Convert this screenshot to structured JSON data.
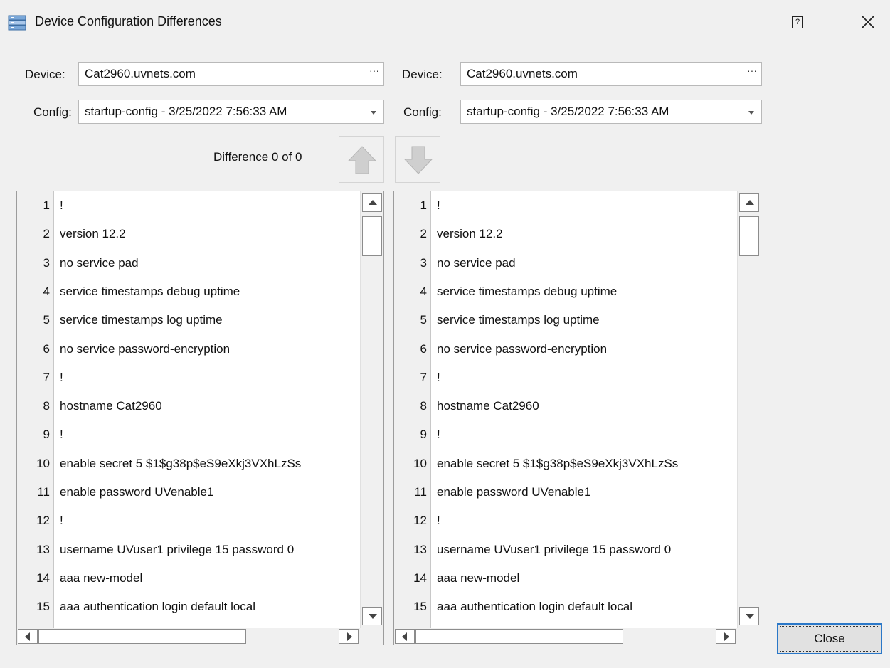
{
  "window": {
    "title": "Device Configuration Differences",
    "help_glyph": "?"
  },
  "left": {
    "device_label": "Device:",
    "device_value": "Cat2960.uvnets.com",
    "browse_glyph": "···",
    "config_label": "Config:",
    "config_value": "startup-config - 3/25/2022 7:56:33 AM"
  },
  "right": {
    "device_label": "Device:",
    "device_value": "Cat2960.uvnets.com",
    "browse_glyph": "···",
    "config_label": "Config:",
    "config_value": "startup-config - 3/25/2022 7:56:33 AM"
  },
  "nav": {
    "difference_text": "Difference 0 of 0",
    "up_icon": "arrow-up-icon",
    "down_icon": "arrow-down-icon"
  },
  "left_pane": {
    "lines": [
      {
        "num": "1",
        "text": "!"
      },
      {
        "num": "2",
        "text": "version 12.2"
      },
      {
        "num": "3",
        "text": "no service pad"
      },
      {
        "num": "4",
        "text": "service timestamps debug uptime"
      },
      {
        "num": "5",
        "text": "service timestamps log uptime"
      },
      {
        "num": "6",
        "text": "no service password-encryption"
      },
      {
        "num": "7",
        "text": "!"
      },
      {
        "num": "8",
        "text": "hostname Cat2960"
      },
      {
        "num": "9",
        "text": "!"
      },
      {
        "num": "10",
        "text": "enable secret 5 $1$g38p$eS9eXkj3VXhLzSs"
      },
      {
        "num": "11",
        "text": "enable password UVenable1"
      },
      {
        "num": "12",
        "text": "!"
      },
      {
        "num": "13",
        "text": "username UVuser1 privilege 15 password 0"
      },
      {
        "num": "14",
        "text": "aaa new-model"
      },
      {
        "num": "15",
        "text": "aaa authentication login default local"
      }
    ]
  },
  "right_pane": {
    "lines": [
      {
        "num": "1",
        "text": "!"
      },
      {
        "num": "2",
        "text": "version 12.2"
      },
      {
        "num": "3",
        "text": "no service pad"
      },
      {
        "num": "4",
        "text": "service timestamps debug uptime"
      },
      {
        "num": "5",
        "text": "service timestamps log uptime"
      },
      {
        "num": "6",
        "text": "no service password-encryption"
      },
      {
        "num": "7",
        "text": "!"
      },
      {
        "num": "8",
        "text": "hostname Cat2960"
      },
      {
        "num": "9",
        "text": "!"
      },
      {
        "num": "10",
        "text": "enable secret 5 $1$g38p$eS9eXkj3VXhLzSs"
      },
      {
        "num": "11",
        "text": "enable password UVenable1"
      },
      {
        "num": "12",
        "text": "!"
      },
      {
        "num": "13",
        "text": "username UVuser1 privilege 15 password 0"
      },
      {
        "num": "14",
        "text": "aaa new-model"
      },
      {
        "num": "15",
        "text": "aaa authentication login default local"
      }
    ]
  },
  "footer": {
    "close_label": "Close"
  }
}
